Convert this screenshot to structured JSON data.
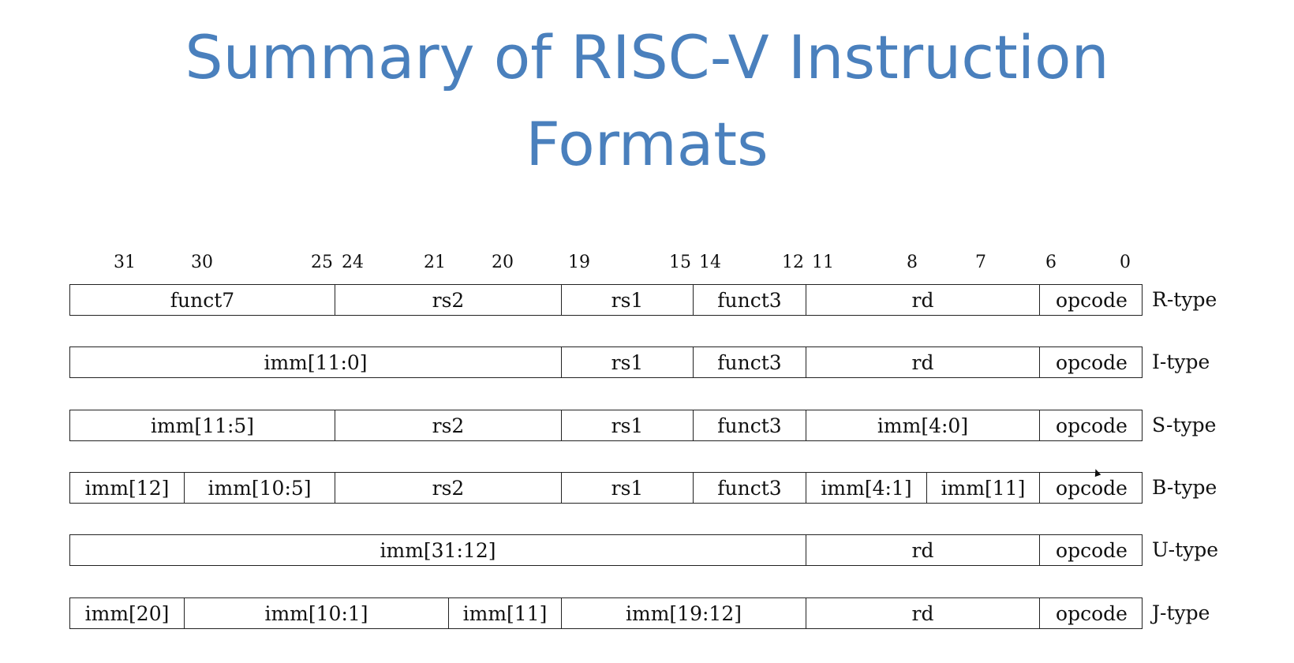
{
  "title": {
    "line1": "Summary of RISC-V Instruction",
    "line2": "Formats"
  },
  "bit_labels": [
    "31",
    "30",
    "25",
    "24",
    "21",
    "20",
    "19",
    "15",
    "14",
    "12",
    "11",
    "8",
    "7",
    "6",
    "0"
  ],
  "formats": [
    {
      "type": "R-type",
      "fields": [
        "funct7",
        "rs2",
        "rs1",
        "funct3",
        "rd",
        "opcode"
      ]
    },
    {
      "type": "I-type",
      "fields": [
        "imm[11:0]",
        "rs1",
        "funct3",
        "rd",
        "opcode"
      ]
    },
    {
      "type": "S-type",
      "fields": [
        "imm[11:5]",
        "rs2",
        "rs1",
        "funct3",
        "imm[4:0]",
        "opcode"
      ]
    },
    {
      "type": "B-type",
      "fields": [
        "imm[12]",
        "imm[10:5]",
        "rs2",
        "rs1",
        "funct3",
        "imm[4:1]",
        "imm[11]",
        "opcode"
      ]
    },
    {
      "type": "U-type",
      "fields": [
        "imm[31:12]",
        "rd",
        "opcode"
      ]
    },
    {
      "type": "J-type",
      "fields": [
        "imm[20]",
        "imm[10:1]",
        "imm[11]",
        "imm[19:12]",
        "rd",
        "opcode"
      ]
    }
  ]
}
